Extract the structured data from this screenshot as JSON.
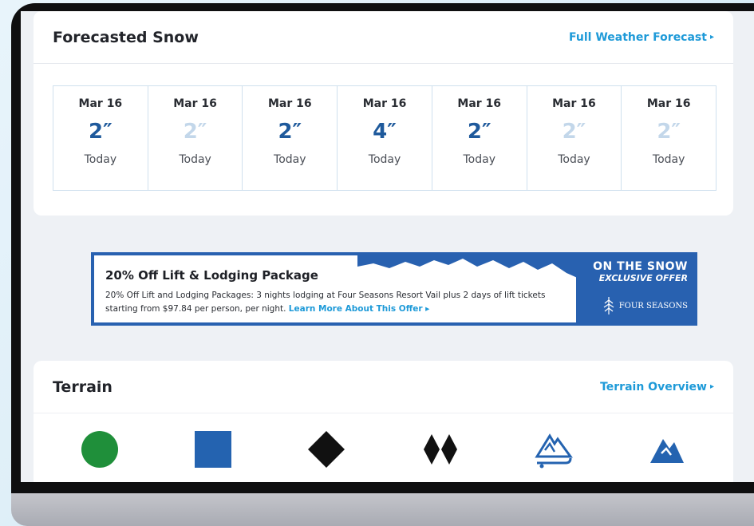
{
  "snow": {
    "title": "Forecasted Snow",
    "link": "Full Weather Forecast",
    "days": [
      {
        "date": "Mar 16",
        "amount": "2″",
        "label": "Today",
        "emphasis": true
      },
      {
        "date": "Mar 16",
        "amount": "2″",
        "label": "Today",
        "emphasis": false
      },
      {
        "date": "Mar 16",
        "amount": "2″",
        "label": "Today",
        "emphasis": true
      },
      {
        "date": "Mar 16",
        "amount": "4″",
        "label": "Today",
        "emphasis": true
      },
      {
        "date": "Mar 16",
        "amount": "2″",
        "label": "Today",
        "emphasis": true
      },
      {
        "date": "Mar 16",
        "amount": "2″",
        "label": "Today",
        "emphasis": false
      },
      {
        "date": "Mar 16",
        "amount": "2″",
        "label": "Today",
        "emphasis": false
      }
    ]
  },
  "promo": {
    "title": "20% Off Lift & Lodging Package",
    "text": "20% Off Lift and Lodging Packages: 3 nights lodging at Four Seasons Resort Vail plus 2 days of lift tickets starting from $97.84 per person, per night.",
    "link": "Learn More About This Offer",
    "brand_line1": "ON THE SNOW",
    "brand_line2": "EXCLUSIVE OFFER",
    "partner": "FOUR SEASONS"
  },
  "terrain": {
    "title": "Terrain",
    "link": "Terrain Overview",
    "icons": [
      "green-circle-icon",
      "blue-square-icon",
      "black-diamond-icon",
      "double-black-diamond-icon",
      "terrain-park-icon",
      "mountain-icon"
    ]
  },
  "colors": {
    "accent_link": "#1e9ad8",
    "snow_dark": "#1f5a9c",
    "snow_light": "#c3d7ea",
    "promo_blue": "#2861b0",
    "green": "#1f8f3a",
    "blue": "#2463b0",
    "black": "#111111"
  }
}
